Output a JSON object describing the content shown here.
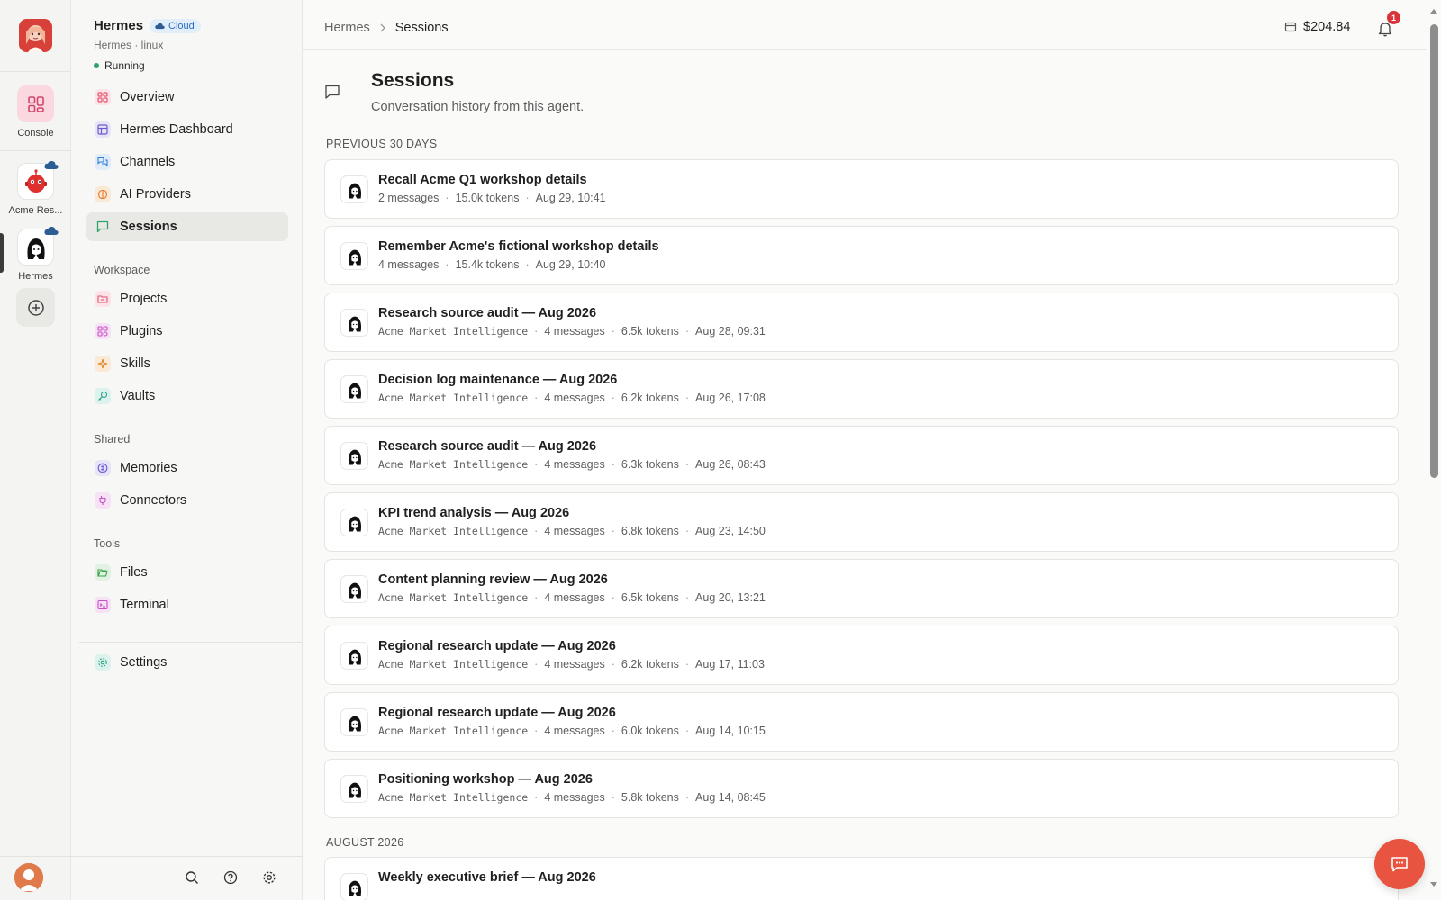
{
  "rail": {
    "console_label": "Console",
    "agents": [
      {
        "label": "Acme Res..."
      },
      {
        "label": "Hermes"
      }
    ]
  },
  "sidebar": {
    "agent_name": "Hermes",
    "cloud_badge": "Cloud",
    "agent_sub": "Hermes · linux",
    "status": "Running",
    "primary": [
      {
        "label": "Overview",
        "icon": "grid-icon",
        "color": "#e2566f"
      },
      {
        "label": "Hermes Dashboard",
        "icon": "layout-icon",
        "color": "#6a5acd"
      },
      {
        "label": "Channels",
        "icon": "chat-bubbles-icon",
        "color": "#2f7fd6"
      },
      {
        "label": "AI Providers",
        "icon": "brain-icon",
        "color": "#e07b2c"
      },
      {
        "label": "Sessions",
        "icon": "message-square-icon",
        "color": "#2fa36b"
      }
    ],
    "workspace_label": "Workspace",
    "workspace": [
      {
        "label": "Projects",
        "icon": "folder-icon",
        "color": "#e2566f"
      },
      {
        "label": "Plugins",
        "icon": "puzzle-icon",
        "color": "#c94fc6"
      },
      {
        "label": "Skills",
        "icon": "sparkle-icon",
        "color": "#e08a2c"
      },
      {
        "label": "Vaults",
        "icon": "key-icon",
        "color": "#2fa38a"
      }
    ],
    "shared_label": "Shared",
    "shared": [
      {
        "label": "Memories",
        "icon": "memory-icon",
        "color": "#6a5acd"
      },
      {
        "label": "Connectors",
        "icon": "plug-icon",
        "color": "#c94fc6"
      }
    ],
    "tools_label": "Tools",
    "tools": [
      {
        "label": "Files",
        "icon": "folder-open-icon",
        "color": "#3a9e4b"
      },
      {
        "label": "Terminal",
        "icon": "terminal-icon",
        "color": "#c94fc6"
      }
    ],
    "settings_label": "Settings"
  },
  "topbar": {
    "crumb_root": "Hermes",
    "crumb_current": "Sessions",
    "balance": "$204.84",
    "notification_count": "1"
  },
  "page": {
    "title": "Sessions",
    "subtitle": "Conversation history from this agent."
  },
  "groups": [
    {
      "label": "PREVIOUS 30 DAYS",
      "sessions": [
        {
          "title": "Recall Acme Q1 workshop details",
          "project": "",
          "messages": "2 messages",
          "tokens": "15.0k tokens",
          "time": "Aug 29, 10:41"
        },
        {
          "title": "Remember Acme's fictional workshop details",
          "project": "",
          "messages": "4 messages",
          "tokens": "15.4k tokens",
          "time": "Aug 29, 10:40"
        },
        {
          "title": "Research source audit — Aug 2026",
          "project": "Acme Market Intelligence",
          "messages": "4 messages",
          "tokens": "6.5k tokens",
          "time": "Aug 28, 09:31"
        },
        {
          "title": "Decision log maintenance — Aug 2026",
          "project": "Acme Market Intelligence",
          "messages": "4 messages",
          "tokens": "6.2k tokens",
          "time": "Aug 26, 17:08"
        },
        {
          "title": "Research source audit — Aug 2026",
          "project": "Acme Market Intelligence",
          "messages": "4 messages",
          "tokens": "6.3k tokens",
          "time": "Aug 26, 08:43"
        },
        {
          "title": "KPI trend analysis — Aug 2026",
          "project": "Acme Market Intelligence",
          "messages": "4 messages",
          "tokens": "6.8k tokens",
          "time": "Aug 23, 14:50"
        },
        {
          "title": "Content planning review — Aug 2026",
          "project": "Acme Market Intelligence",
          "messages": "4 messages",
          "tokens": "6.5k tokens",
          "time": "Aug 20, 13:21"
        },
        {
          "title": "Regional research update — Aug 2026",
          "project": "Acme Market Intelligence",
          "messages": "4 messages",
          "tokens": "6.2k tokens",
          "time": "Aug 17, 11:03"
        },
        {
          "title": "Regional research update — Aug 2026",
          "project": "Acme Market Intelligence",
          "messages": "4 messages",
          "tokens": "6.0k tokens",
          "time": "Aug 14, 10:15"
        },
        {
          "title": "Positioning workshop — Aug 2026",
          "project": "Acme Market Intelligence",
          "messages": "4 messages",
          "tokens": "5.8k tokens",
          "time": "Aug 14, 08:45"
        }
      ]
    },
    {
      "label": "AUGUST 2026",
      "sessions": [
        {
          "title": "Weekly executive brief — Aug 2026",
          "project": "",
          "messages": "",
          "tokens": "",
          "time": ""
        }
      ]
    }
  ]
}
